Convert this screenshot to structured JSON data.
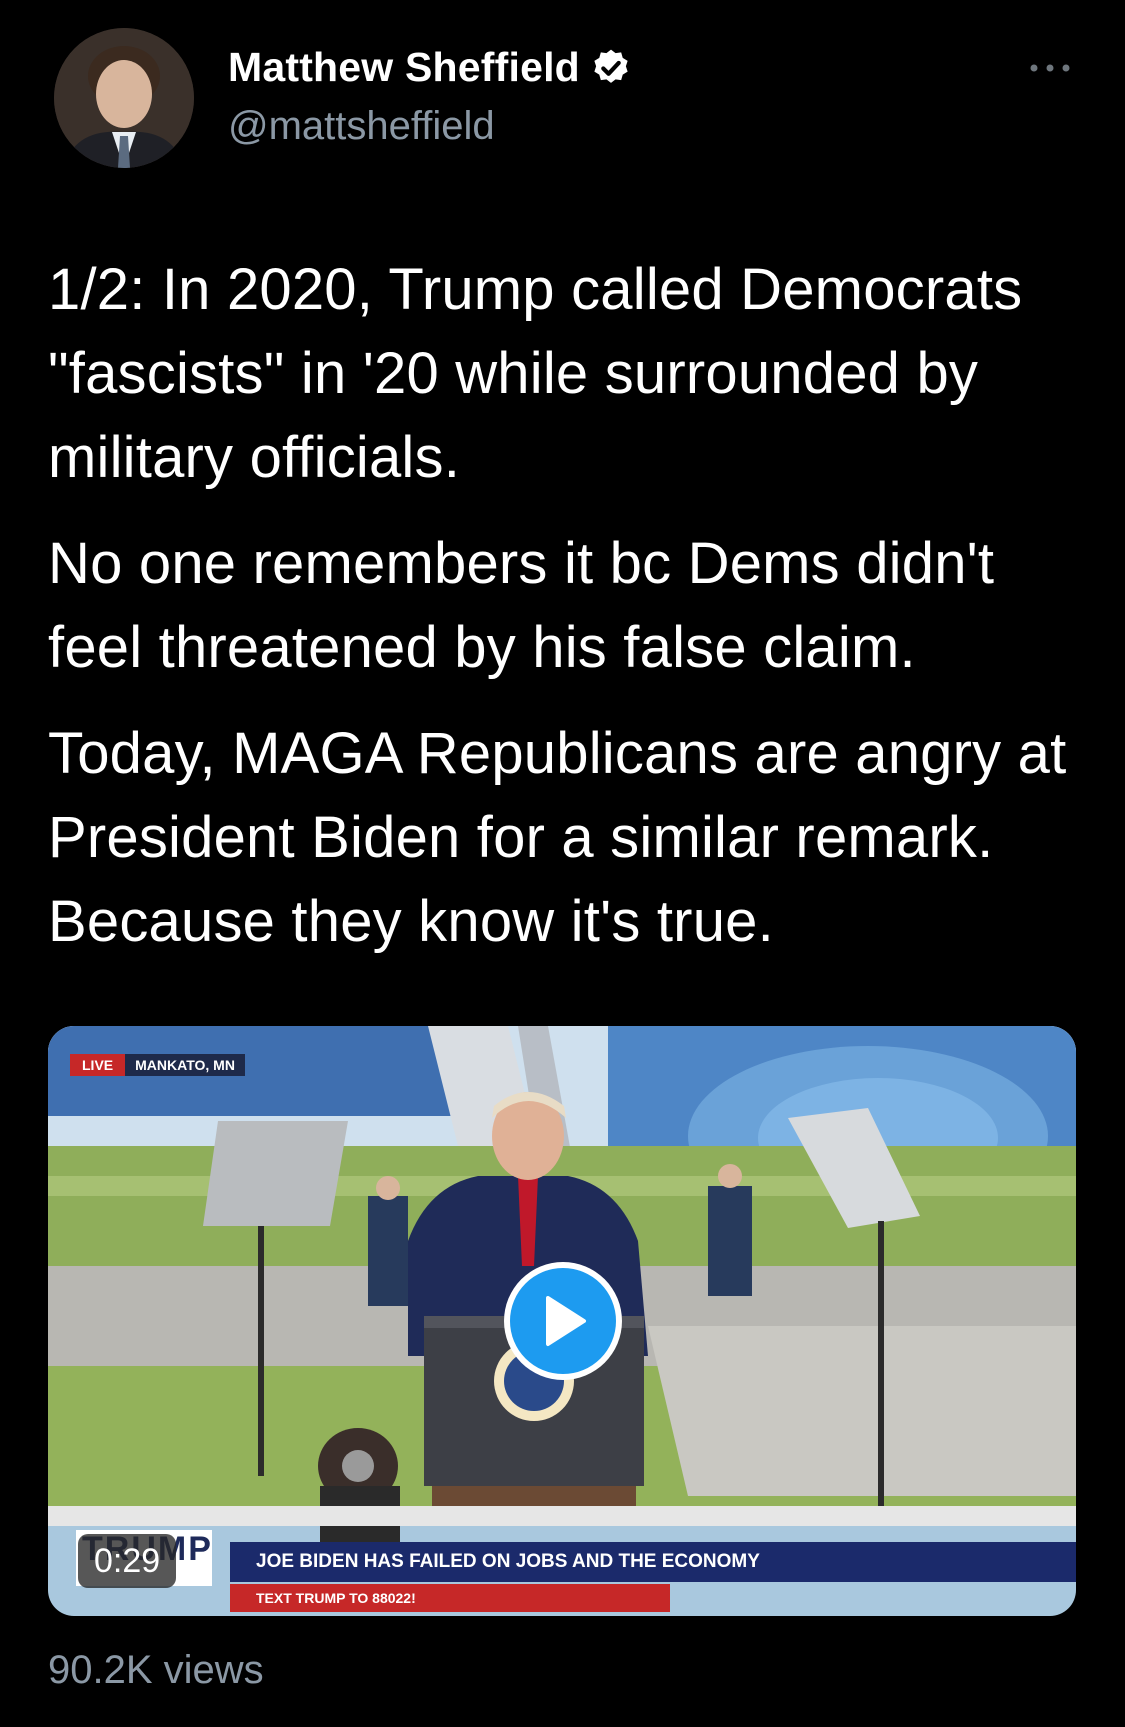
{
  "author": {
    "name": "Matthew Sheffield",
    "handle": "@mattsheffield",
    "verified": true,
    "avatar_icon": "profile-avatar"
  },
  "tweet": {
    "paragraphs": [
      "1/2: In 2020, Trump called Democrats \"fascists\" in '20 while surrounded by military officials.",
      "No one remembers it bc Dems didn't feel threatened by his false claim.",
      "Today, MAGA Republicans are angry at President Biden for a similar remark. Because they know it's true."
    ]
  },
  "video": {
    "duration": "0:29",
    "live_label": "LIVE",
    "location_label": "MANKATO, MN",
    "logo_text": "TRUMP",
    "headline": "JOE BIDEN HAS FAILED ON JOBS AND THE ECONOMY",
    "subline": "TEXT TRUMP TO 88022!",
    "play_icon": "play-icon"
  },
  "stats": {
    "views": "90.2K views"
  },
  "colors": {
    "background": "#000000",
    "secondary_text": "#8b98a5",
    "accent": "#1d9bf0"
  }
}
